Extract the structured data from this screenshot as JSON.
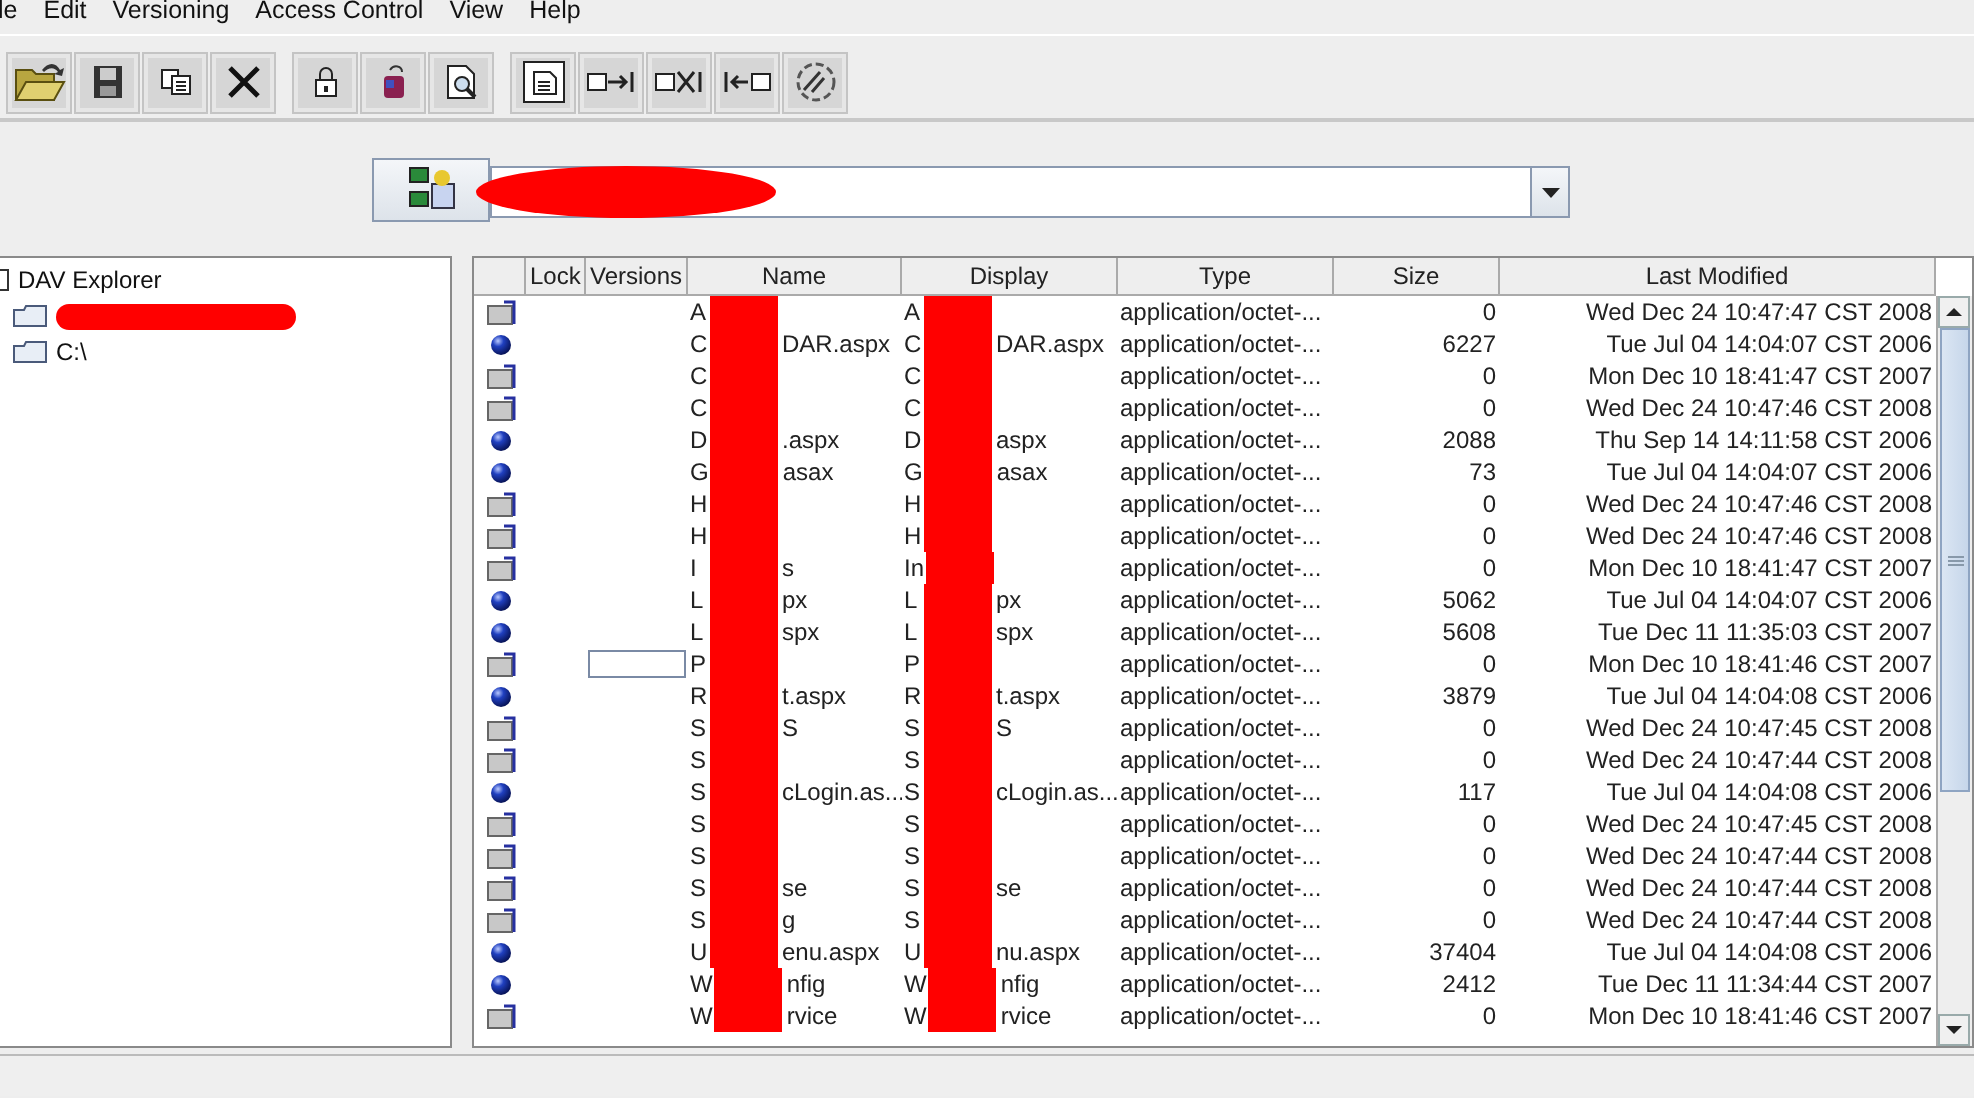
{
  "menu": [
    "le",
    "Edit",
    "Versioning",
    "Access Control",
    "View",
    "Help"
  ],
  "toolbar": [
    [
      {
        "kind": "open"
      },
      {
        "kind": "save"
      },
      {
        "kind": "copy"
      },
      {
        "kind": "delete"
      }
    ],
    [
      {
        "kind": "lock"
      },
      {
        "kind": "unlock"
      },
      {
        "kind": "view"
      }
    ],
    [
      {
        "kind": "properties"
      },
      {
        "kind": "put"
      },
      {
        "kind": "remove"
      },
      {
        "kind": "get"
      },
      {
        "kind": "refresh"
      }
    ]
  ],
  "tree": {
    "label": "DAV Explorer",
    "children": [
      {
        "kind": "drive"
      },
      {
        "kind": "drive",
        "label": "C:\\"
      }
    ]
  },
  "table": {
    "columns": [
      "Lock",
      "Versions",
      "Name",
      "Display",
      "Type",
      "Size",
      "Last Modified"
    ],
    "rows": [
      {
        "kind": "folder",
        "name": [
          "A"
        ],
        "display": [
          "A"
        ],
        "type": "application/octet-...",
        "size": "0",
        "modified": "Wed Dec 24 10:47:47 CST 2008"
      },
      {
        "kind": "file",
        "name": [
          "C",
          "DAR.aspx"
        ],
        "display": [
          "C",
          "DAR.aspx"
        ],
        "type": "application/octet-...",
        "size": "6227",
        "modified": "Tue Jul 04 14:04:07 CST 2006"
      },
      {
        "kind": "folder",
        "name": [
          "C"
        ],
        "display": [
          "C"
        ],
        "type": "application/octet-...",
        "size": "0",
        "modified": "Mon Dec 10 18:41:47 CST 2007"
      },
      {
        "kind": "folder",
        "name": [
          "C"
        ],
        "display": [
          "C"
        ],
        "type": "application/octet-...",
        "size": "0",
        "modified": "Wed Dec 24 10:47:46 CST 2008"
      },
      {
        "kind": "file",
        "name": [
          "D",
          ".aspx"
        ],
        "display": [
          "D",
          "aspx"
        ],
        "type": "application/octet-...",
        "size": "2088",
        "modified": "Thu Sep 14 14:11:58 CST 2006"
      },
      {
        "kind": "file",
        "name": [
          "G",
          "asax"
        ],
        "display": [
          "G",
          "asax"
        ],
        "type": "application/octet-...",
        "size": "73",
        "modified": "Tue Jul 04 14:04:07 CST 2006"
      },
      {
        "kind": "folder",
        "name": [
          "H"
        ],
        "display": [
          "H"
        ],
        "type": "application/octet-...",
        "size": "0",
        "modified": "Wed Dec 24 10:47:46 CST 2008"
      },
      {
        "kind": "folder",
        "name": [
          "H"
        ],
        "display": [
          "H"
        ],
        "type": "application/octet-...",
        "size": "0",
        "modified": "Wed Dec 24 10:47:46 CST 2008"
      },
      {
        "kind": "folder",
        "name": [
          "I",
          "s"
        ],
        "display": [
          "In"
        ],
        "type": "application/octet-...",
        "size": "0",
        "modified": "Mon Dec 10 18:41:47 CST 2007"
      },
      {
        "kind": "file",
        "name": [
          "L",
          "px"
        ],
        "display": [
          "L",
          "px"
        ],
        "type": "application/octet-...",
        "size": "5062",
        "modified": "Tue Jul 04 14:04:07 CST 2006"
      },
      {
        "kind": "file",
        "name": [
          "L",
          "spx"
        ],
        "display": [
          "L",
          "spx"
        ],
        "type": "application/octet-...",
        "size": "5608",
        "modified": "Tue Dec 11 11:35:03 CST 2007"
      },
      {
        "kind": "folder",
        "editing": true,
        "name": [
          "P"
        ],
        "display": [
          "P"
        ],
        "type": "application/octet-...",
        "size": "0",
        "modified": "Mon Dec 10 18:41:46 CST 2007"
      },
      {
        "kind": "file",
        "name": [
          "R",
          "t.aspx"
        ],
        "display": [
          "R",
          "t.aspx"
        ],
        "type": "application/octet-...",
        "size": "3879",
        "modified": "Tue Jul 04 14:04:08 CST 2006"
      },
      {
        "kind": "folder",
        "name": [
          "S",
          "S"
        ],
        "display": [
          "S",
          "S"
        ],
        "type": "application/octet-...",
        "size": "0",
        "modified": "Wed Dec 24 10:47:45 CST 2008"
      },
      {
        "kind": "folder",
        "name": [
          "S"
        ],
        "display": [
          "S"
        ],
        "type": "application/octet-...",
        "size": "0",
        "modified": "Wed Dec 24 10:47:44 CST 2008"
      },
      {
        "kind": "file",
        "name": [
          "S",
          "cLogin.as..."
        ],
        "display": [
          "S",
          "cLogin.as..."
        ],
        "type": "application/octet-...",
        "size": "117",
        "modified": "Tue Jul 04 14:04:08 CST 2006"
      },
      {
        "kind": "folder",
        "name": [
          "S"
        ],
        "display": [
          "S"
        ],
        "type": "application/octet-...",
        "size": "0",
        "modified": "Wed Dec 24 10:47:45 CST 2008"
      },
      {
        "kind": "folder",
        "name": [
          "S"
        ],
        "display": [
          "S"
        ],
        "type": "application/octet-...",
        "size": "0",
        "modified": "Wed Dec 24 10:47:44 CST 2008"
      },
      {
        "kind": "folder",
        "name": [
          "S",
          "se"
        ],
        "display": [
          "S",
          "se"
        ],
        "type": "application/octet-...",
        "size": "0",
        "modified": "Wed Dec 24 10:47:44 CST 2008"
      },
      {
        "kind": "folder",
        "name": [
          "S",
          "g"
        ],
        "display": [
          "S"
        ],
        "type": "application/octet-...",
        "size": "0",
        "modified": "Wed Dec 24 10:47:44 CST 2008"
      },
      {
        "kind": "file",
        "name": [
          "U",
          "enu.aspx"
        ],
        "display": [
          "U",
          "nu.aspx"
        ],
        "type": "application/octet-...",
        "size": "37404",
        "modified": "Tue Jul 04 14:04:08 CST 2006"
      },
      {
        "kind": "file",
        "name": [
          "W",
          "nfig"
        ],
        "display": [
          "W",
          "nfig"
        ],
        "type": "application/octet-...",
        "size": "2412",
        "modified": "Tue Dec 11 11:34:44 CST 2007"
      },
      {
        "kind": "folder",
        "name": [
          "W",
          "rvice"
        ],
        "display": [
          "W",
          "rvice"
        ],
        "type": "application/octet-...",
        "size": "0",
        "modified": "Mon Dec 10 18:41:46 CST 2007"
      }
    ]
  }
}
